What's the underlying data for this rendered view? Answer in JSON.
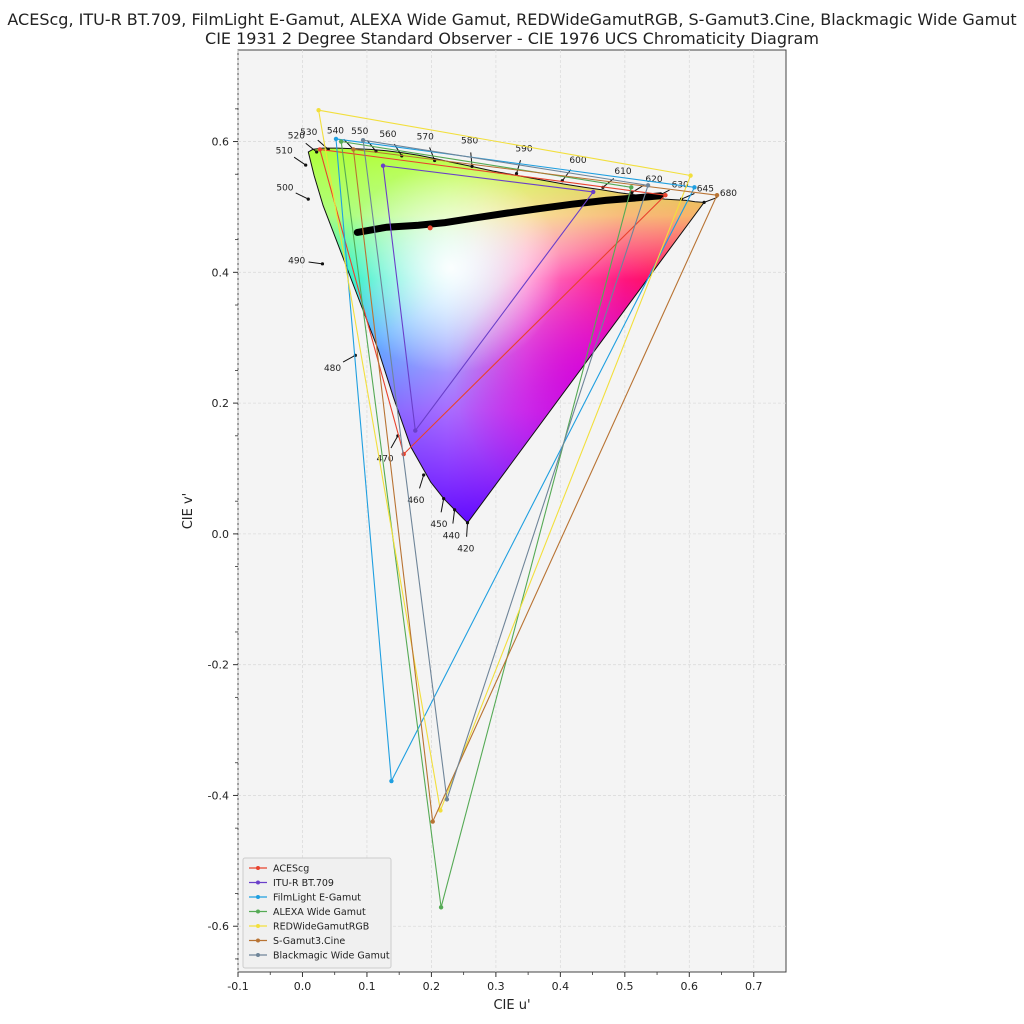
{
  "title_line1": "ACEScg, ITU-R BT.709, FilmLight E-Gamut, ALEXA Wide Gamut, REDWideGamutRGB, S-Gamut3.Cine, Blackmagic Wide Gamut",
  "title_line2": "CIE 1931 2 Degree Standard Observer - CIE 1976 UCS Chromaticity Diagram",
  "chart_data": {
    "type": "scatter",
    "xlabel": "CIE u'",
    "ylabel": "CIE v'",
    "xlim": [
      -0.1,
      0.75
    ],
    "ylim": [
      -0.67,
      0.74
    ],
    "grid": true,
    "legend_position": "lower-left",
    "x_ticks": [
      "-0.1",
      "0.0",
      "0.1",
      "0.2",
      "0.3",
      "0.4",
      "0.5",
      "0.6",
      "0.7"
    ],
    "y_ticks": [
      "-0.6",
      "-0.4",
      "-0.2",
      "0.0",
      "0.2",
      "0.4",
      "0.6"
    ],
    "spectral_locus": [
      [
        0.256,
        0.017
      ],
      [
        0.252,
        0.021
      ],
      [
        0.234,
        0.039
      ],
      [
        0.219,
        0.054
      ],
      [
        0.199,
        0.079
      ],
      [
        0.168,
        0.133
      ],
      [
        0.141,
        0.209
      ],
      [
        0.117,
        0.283
      ],
      [
        0.082,
        0.373
      ],
      [
        0.055,
        0.443
      ],
      [
        0.032,
        0.502
      ],
      [
        0.018,
        0.548
      ],
      [
        0.009,
        0.584
      ],
      [
        0.016,
        0.588
      ],
      [
        0.031,
        0.59
      ],
      [
        0.055,
        0.59
      ],
      [
        0.08,
        0.589
      ],
      [
        0.105,
        0.588
      ],
      [
        0.13,
        0.586
      ],
      [
        0.155,
        0.583
      ],
      [
        0.18,
        0.579
      ],
      [
        0.205,
        0.574
      ],
      [
        0.233,
        0.568
      ],
      [
        0.262,
        0.562
      ],
      [
        0.295,
        0.555
      ],
      [
        0.333,
        0.548
      ],
      [
        0.372,
        0.541
      ],
      [
        0.405,
        0.535
      ],
      [
        0.437,
        0.53
      ],
      [
        0.465,
        0.526
      ],
      [
        0.49,
        0.522
      ],
      [
        0.512,
        0.519
      ],
      [
        0.531,
        0.516
      ],
      [
        0.548,
        0.514
      ],
      [
        0.562,
        0.512
      ],
      [
        0.578,
        0.511
      ],
      [
        0.595,
        0.51
      ],
      [
        0.609,
        0.508
      ],
      [
        0.623,
        0.507
      ]
    ],
    "wavelength_labels": [
      {
        "label": "420",
        "u": 0.256,
        "v": 0.017
      },
      {
        "label": "440",
        "u": 0.236,
        "v": 0.037
      },
      {
        "label": "450",
        "u": 0.219,
        "v": 0.054
      },
      {
        "label": "460",
        "u": 0.188,
        "v": 0.09
      },
      {
        "label": "470",
        "u": 0.148,
        "v": 0.15
      },
      {
        "label": "480",
        "u": 0.082,
        "v": 0.273
      },
      {
        "label": "490",
        "u": 0.031,
        "v": 0.413
      },
      {
        "label": "500",
        "u": 0.009,
        "v": 0.512
      },
      {
        "label": "510",
        "u": 0.005,
        "v": 0.564
      },
      {
        "label": "520",
        "u": 0.022,
        "v": 0.584
      },
      {
        "label": "530",
        "u": 0.04,
        "v": 0.588
      },
      {
        "label": "540",
        "u": 0.079,
        "v": 0.588
      },
      {
        "label": "550",
        "u": 0.114,
        "v": 0.585
      },
      {
        "label": "560",
        "u": 0.154,
        "v": 0.578
      },
      {
        "label": "570",
        "u": 0.205,
        "v": 0.571
      },
      {
        "label": "580",
        "u": 0.263,
        "v": 0.562
      },
      {
        "label": "590",
        "u": 0.332,
        "v": 0.551
      },
      {
        "label": "600",
        "u": 0.403,
        "v": 0.54
      },
      {
        "label": "610",
        "u": 0.466,
        "v": 0.53
      },
      {
        "label": "620",
        "u": 0.511,
        "v": 0.522
      },
      {
        "label": "630",
        "u": 0.55,
        "v": 0.516
      },
      {
        "label": "645",
        "u": 0.588,
        "v": 0.512
      },
      {
        "label": "680",
        "u": 0.623,
        "v": 0.507
      }
    ],
    "series": [
      {
        "name": "ACEScg",
        "color": "#e8432e",
        "points": [
          [
            0.563,
            0.518
          ],
          [
            0.027,
            0.588
          ],
          [
            0.157,
            0.122
          ]
        ]
      },
      {
        "name": "ITU-R BT.709",
        "color": "#6a3fc9",
        "points": [
          [
            0.451,
            0.523
          ],
          [
            0.125,
            0.563
          ],
          [
            0.175,
            0.158
          ]
        ]
      },
      {
        "name": "FilmLight E-Gamut",
        "color": "#1f9fe0",
        "points": [
          [
            0.608,
            0.53
          ],
          [
            0.052,
            0.604
          ],
          [
            0.138,
            -0.378
          ]
        ]
      },
      {
        "name": "ALEXA Wide Gamut",
        "color": "#55aa55",
        "points": [
          [
            0.51,
            0.53
          ],
          [
            0.06,
            0.6
          ],
          [
            0.215,
            -0.571
          ]
        ]
      },
      {
        "name": "REDWideGamutRGB",
        "color": "#f2df3c",
        "points": [
          [
            0.602,
            0.548
          ],
          [
            0.025,
            0.648
          ],
          [
            0.214,
            -0.423
          ]
        ]
      },
      {
        "name": "S-Gamut3.Cine",
        "color": "#b87333",
        "points": [
          [
            0.643,
            0.518
          ],
          [
            0.079,
            0.588
          ],
          [
            0.202,
            -0.44
          ]
        ]
      },
      {
        "name": "Blackmagic Wide Gamut",
        "color": "#6f8599",
        "points": [
          [
            0.536,
            0.533
          ],
          [
            0.094,
            0.602
          ],
          [
            0.224,
            -0.406
          ]
        ]
      }
    ],
    "planckian_locus": [
      [
        0.085,
        0.461
      ],
      [
        0.131,
        0.469
      ],
      [
        0.18,
        0.472
      ],
      [
        0.221,
        0.476
      ],
      [
        0.266,
        0.483
      ],
      [
        0.313,
        0.49
      ],
      [
        0.364,
        0.497
      ],
      [
        0.417,
        0.504
      ],
      [
        0.47,
        0.51
      ],
      [
        0.52,
        0.514
      ],
      [
        0.555,
        0.517
      ]
    ],
    "white_point": [
      0.198,
      0.468
    ]
  }
}
